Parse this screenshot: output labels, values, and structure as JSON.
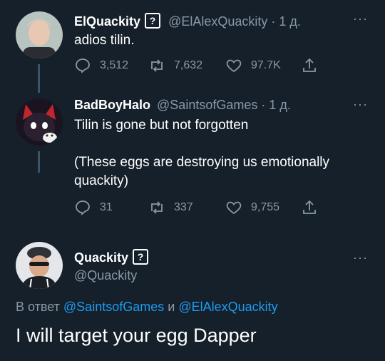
{
  "tweets": [
    {
      "name": "ElQuackity",
      "verified_glyph": "?",
      "handle": "@ElAlexQuackity",
      "time": "· 1 д.",
      "text": "adios tilin.",
      "replies": "3,512",
      "retweets": "7,632",
      "likes": "97.7K"
    },
    {
      "name": "BadBoyHalo",
      "handle": "@SaintsofGames",
      "time": "· 1 д.",
      "text_line1": "Tilin is gone but not forgotten",
      "text_line2": "(These eggs are destroying us emotionally",
      "text_line3": "quackity)",
      "replies": "31",
      "retweets": "337",
      "likes": "9,755"
    }
  ],
  "main_tweet": {
    "name": "Quackity",
    "verified_glyph": "?",
    "handle": "@Quackity",
    "reply_prefix": "В ответ",
    "reply_user1": "@SaintsofGames",
    "reply_and": "и",
    "reply_user2": "@ElAlexQuackity",
    "text": "I will target your egg Dapper"
  },
  "more_glyph": "···",
  "colors": {
    "background": "#15202b",
    "muted": "#8b98a5",
    "link": "#1d9bf0",
    "thread_line": "#3d5466"
  }
}
